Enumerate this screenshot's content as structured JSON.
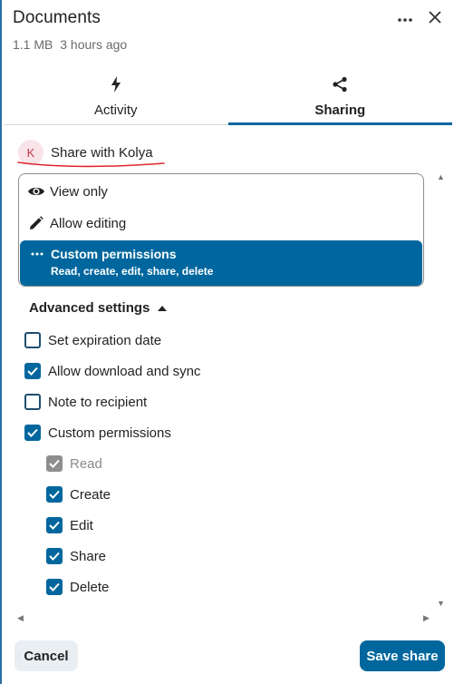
{
  "header": {
    "title": "Documents",
    "size": "1.1 MB",
    "modified": "3 hours ago",
    "more_icon": "more-horizontal-icon",
    "close_icon": "close-icon"
  },
  "tabs": [
    {
      "label": "Activity",
      "icon": "lightning-icon",
      "active": false
    },
    {
      "label": "Sharing",
      "icon": "share-icon",
      "active": true
    }
  ],
  "share": {
    "avatar_initial": "K",
    "label": "Share with Kolya"
  },
  "permissions": {
    "options": [
      {
        "label": "View only",
        "icon": "eye-icon"
      },
      {
        "label": "Allow editing",
        "icon": "pencil-icon"
      },
      {
        "label": "Custom permissions",
        "sublabel": "Read, create, edit, share, delete",
        "icon": "dots-icon",
        "selected": true
      }
    ]
  },
  "advanced": {
    "label": "Advanced settings",
    "expanded": true,
    "options": [
      {
        "label": "Set expiration date",
        "checked": false
      },
      {
        "label": "Allow download and sync",
        "checked": true
      },
      {
        "label": "Note to recipient",
        "checked": false
      },
      {
        "label": "Custom permissions",
        "checked": true
      }
    ],
    "custom": [
      {
        "label": "Read",
        "checked": true,
        "disabled": true
      },
      {
        "label": "Create",
        "checked": true
      },
      {
        "label": "Edit",
        "checked": true
      },
      {
        "label": "Share",
        "checked": true
      },
      {
        "label": "Delete",
        "checked": true
      }
    ]
  },
  "footer": {
    "cancel_label": "Cancel",
    "save_label": "Save share"
  },
  "colors": {
    "accent": "#00679e",
    "annotation": "#e0262e"
  }
}
